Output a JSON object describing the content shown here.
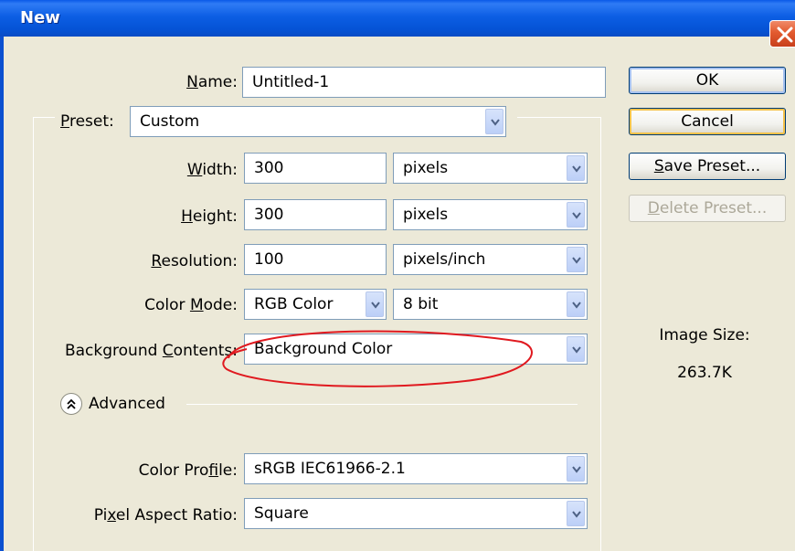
{
  "window": {
    "title": "New"
  },
  "form": {
    "name": {
      "label_u": "N",
      "label_rest": "ame:",
      "value": "Untitled-1"
    },
    "preset": {
      "label_u": "P",
      "label_rest": "reset:",
      "value": "Custom"
    },
    "width": {
      "label_u": "W",
      "label_rest": "idth:",
      "value": "300",
      "unit": "pixels"
    },
    "height": {
      "label_u": "H",
      "label_rest": "eight:",
      "value": "300",
      "unit": "pixels"
    },
    "resolution": {
      "label_u": "R",
      "label_rest": "esolution:",
      "value": "100",
      "unit": "pixels/inch"
    },
    "color_mode": {
      "label_pre": "Color ",
      "label_u": "M",
      "label_rest": "ode:",
      "value": "RGB Color",
      "depth": "8 bit"
    },
    "background_contents": {
      "label_pre": "Background ",
      "label_u": "C",
      "label_rest": "ontents:",
      "value": "Background Color"
    },
    "advanced": {
      "label": "Advanced"
    },
    "color_profile": {
      "label_pre": "Color Pro",
      "label_u": "f",
      "label_rest": "ile:",
      "value": "sRGB IEC61966-2.1"
    },
    "pixel_aspect_ratio": {
      "label_pre": "Pi",
      "label_u": "x",
      "label_rest": "el Aspect Ratio:",
      "value": "Square"
    }
  },
  "buttons": {
    "ok": "OK",
    "cancel": "Cancel",
    "save_preset_u": "S",
    "save_preset_rest": "ave Preset...",
    "delete_preset_u": "D",
    "delete_preset_rest": "elete Preset..."
  },
  "image_size": {
    "label": "Image Size:",
    "value": "263.7K"
  },
  "colors": {
    "titlebar": "#0553d6",
    "window_bg": "#ece9d8",
    "input_border": "#7f9db9",
    "annotation": "#e0191f"
  }
}
